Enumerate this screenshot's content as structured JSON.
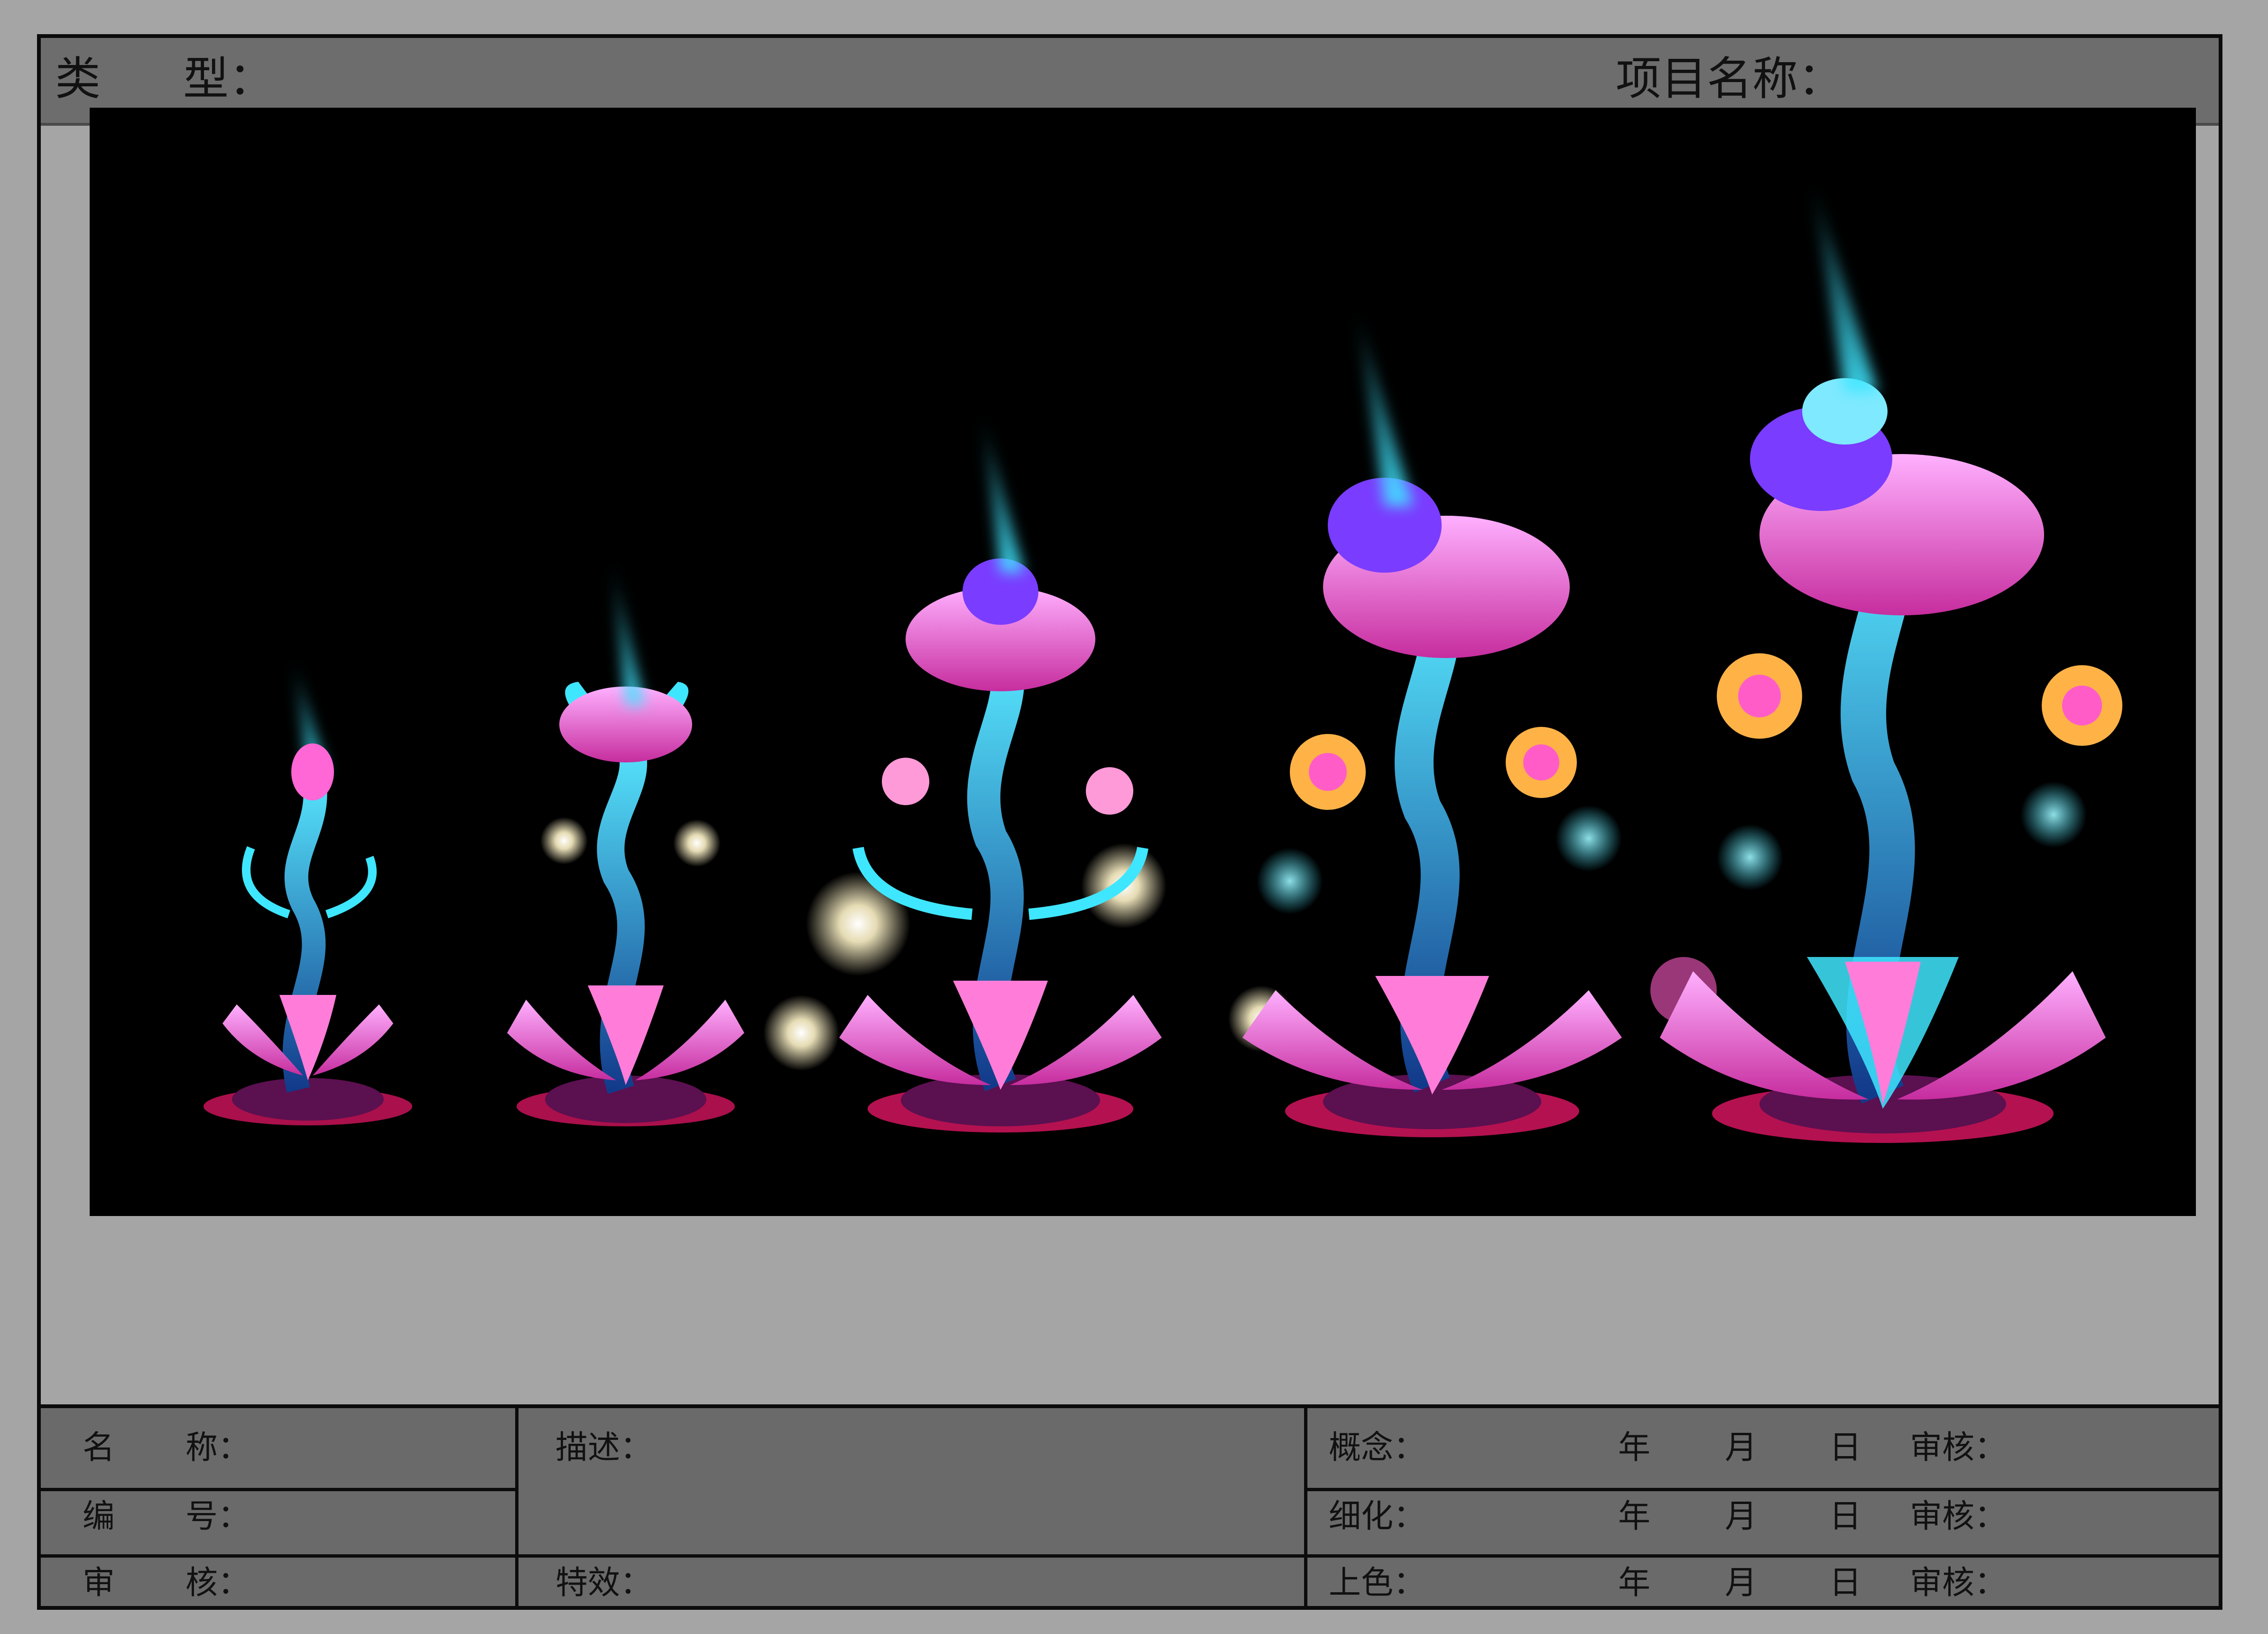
{
  "header": {
    "type_label": "类",
    "type_label_2": "型：",
    "project_label": "项目名称："
  },
  "artwork": {
    "description": "",
    "colors": {
      "background": "#000000",
      "pink": "#ff5cc8",
      "cyan": "#3fe6ff",
      "violet": "#7a3cff",
      "glow": "#fff4c8"
    }
  },
  "footer": {
    "name_label_a": "名",
    "name_label_b": "称：",
    "number_label_a": "编",
    "number_label_b": "号：",
    "review_label_a": "审",
    "review_label_b": "核：",
    "description_label": "描述：",
    "effects_label": "特效：",
    "rows": [
      {
        "stage": "概念：",
        "year": "年",
        "month": "月",
        "day": "日",
        "review": "审核："
      },
      {
        "stage": "细化：",
        "year": "年",
        "month": "月",
        "day": "日",
        "review": "审核："
      },
      {
        "stage": "上色：",
        "year": "年",
        "month": "月",
        "day": "日",
        "review": "审核："
      }
    ]
  }
}
